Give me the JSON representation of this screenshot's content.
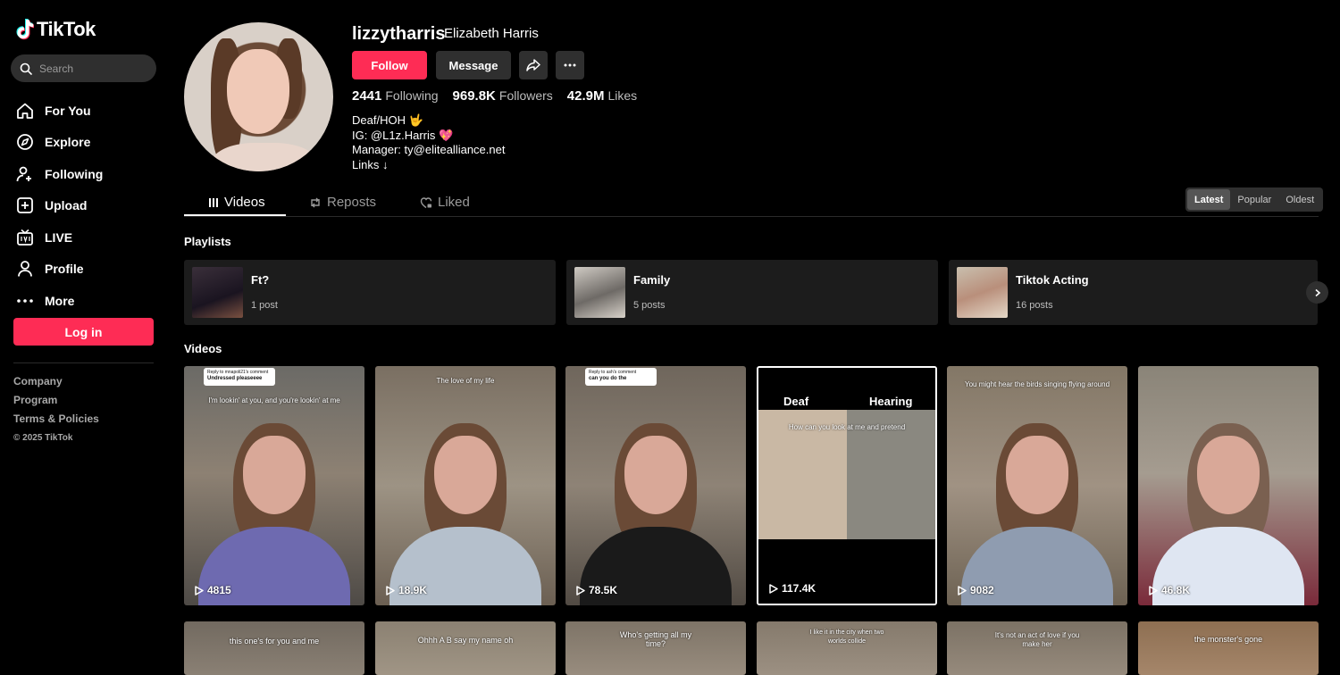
{
  "brand": {
    "name": "TikTok",
    "accent": "#fe2c55"
  },
  "search": {
    "placeholder": "Search"
  },
  "nav": [
    {
      "label": "For You",
      "icon": "home-icon"
    },
    {
      "label": "Explore",
      "icon": "compass-icon"
    },
    {
      "label": "Following",
      "icon": "person-plus-icon"
    },
    {
      "label": "Upload",
      "icon": "plus-square-icon"
    },
    {
      "label": "LIVE",
      "icon": "tv-icon"
    },
    {
      "label": "Profile",
      "icon": "person-icon"
    },
    {
      "label": "More",
      "icon": "dots-icon"
    }
  ],
  "login_label": "Log in",
  "footer": {
    "links": [
      "Company",
      "Program",
      "Terms & Policies"
    ],
    "copyright": "© 2025 TikTok"
  },
  "profile": {
    "username": "lizzytharris",
    "fullname": "Elizabeth Harris",
    "follow_label": "Follow",
    "message_label": "Message",
    "stats": {
      "following_value": "2441",
      "following_label": "Following",
      "followers_value": "969.8K",
      "followers_label": "Followers",
      "likes_value": "42.9M",
      "likes_label": "Likes"
    },
    "bio": [
      "Deaf/HOH 🤟",
      "IG: @L1z.Harris 💖",
      "Manager: ty@elitealliance.net",
      "Links ↓"
    ]
  },
  "tabs": [
    {
      "label": "Videos",
      "active": true
    },
    {
      "label": "Reposts",
      "active": false
    },
    {
      "label": "Liked",
      "active": false
    }
  ],
  "sort": [
    {
      "label": "Latest",
      "active": true
    },
    {
      "label": "Popular",
      "active": false
    },
    {
      "label": "Oldest",
      "active": false
    }
  ],
  "playlists_title": "Playlists",
  "playlists": [
    {
      "name": "Ft?",
      "count": "1 post"
    },
    {
      "name": "Family",
      "count": "5 posts"
    },
    {
      "name": "Tiktok Acting",
      "count": "16 posts"
    }
  ],
  "videos_title": "Videos",
  "videos": [
    {
      "views": "4815",
      "caption": "I'm lookin' at you, and you're lookin' at me",
      "reply_head": "Reply to mnapoli21's comment",
      "reply_text": "Undressed pleaseeee"
    },
    {
      "views": "18.9K",
      "caption": "The love of my life"
    },
    {
      "views": "78.5K",
      "caption": "",
      "reply_head": "Reply to ash's comment",
      "reply_text": "can you do the"
    },
    {
      "views": "117.4K",
      "caption": "How can you look at me and pretend",
      "split_left": "Deaf",
      "split_right": "Hearing"
    },
    {
      "views": "9082",
      "caption": "You might hear the birds singing flying around"
    },
    {
      "views": "46.8K",
      "caption": ""
    }
  ],
  "videos_row2": [
    {
      "caption": "this one's for you and me"
    },
    {
      "caption": "Ohhh A B say my name oh"
    },
    {
      "caption": "Who's getting all my time?"
    },
    {
      "caption": "I like it in the city when two worlds collide"
    },
    {
      "caption": "It's not an act of love if you make her"
    },
    {
      "caption": "the monster's gone"
    }
  ]
}
